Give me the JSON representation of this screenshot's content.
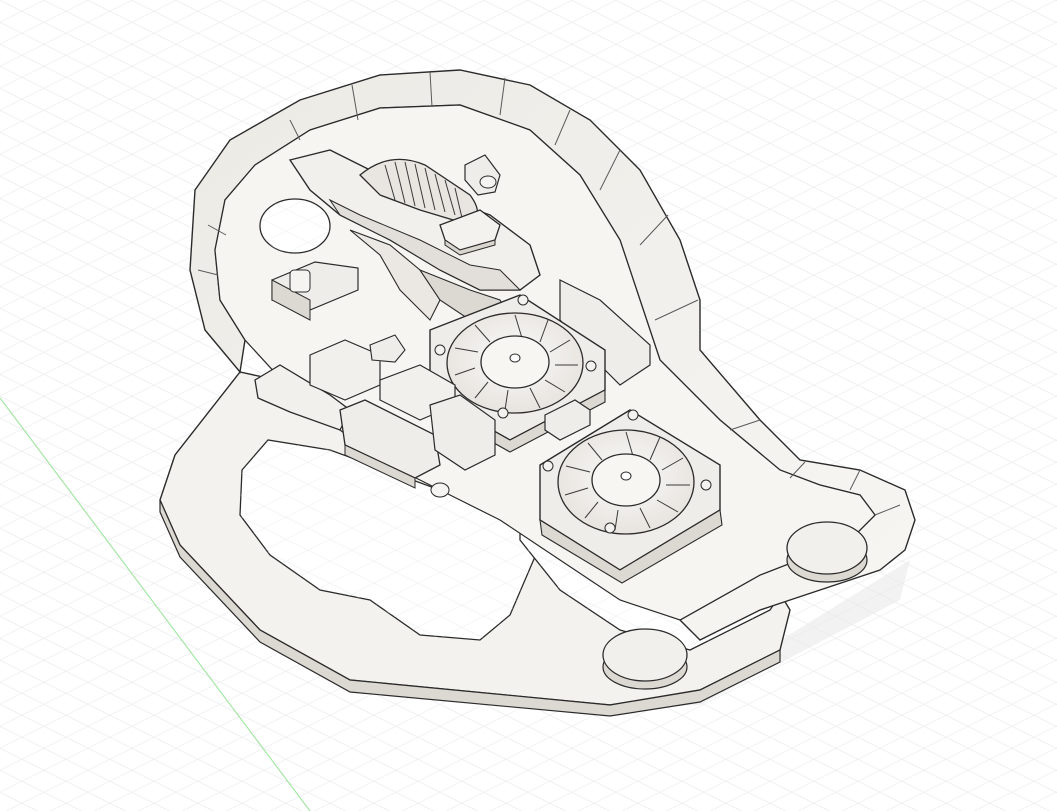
{
  "viewport": {
    "background": "#ffffff",
    "grid_color": "#d6d9de",
    "axis_color": "#9be39b"
  },
  "model": {
    "body_fill": "#f3f1ed",
    "body_shade": "#e4e1dc",
    "edge_color": "#2b2b2b",
    "parts": [
      "outer-shell",
      "base-plate",
      "scroll-wheel",
      "scroll-wheel-bracket",
      "fan-upper",
      "fan-lower",
      "switch-left",
      "switch-right",
      "cable-connectors",
      "glide-feet"
    ]
  }
}
